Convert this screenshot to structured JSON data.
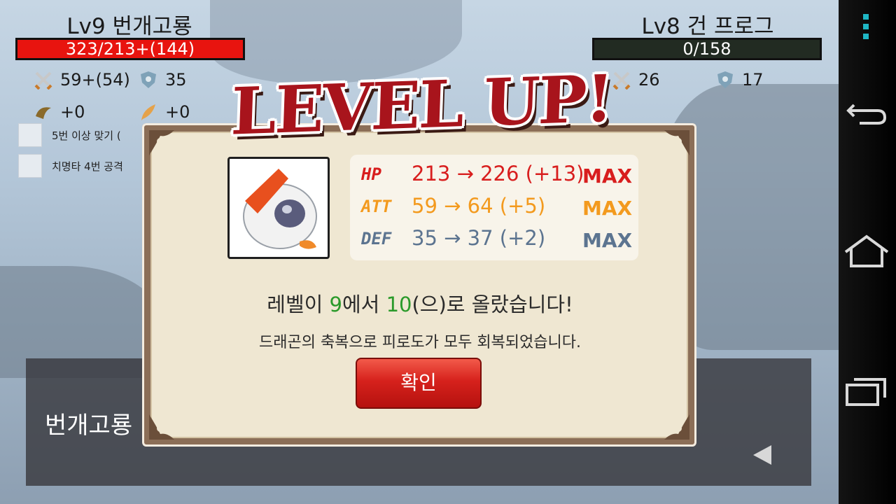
{
  "player": {
    "name": "Lv9 번개고룡",
    "hp_text": "323/213+(144)",
    "attack": "59+(54)",
    "defense": "35",
    "bonus1": "+0",
    "bonus2": "+0"
  },
  "enemy": {
    "name": "Lv8 건 프로그",
    "hp_text": "0/158",
    "attack": "26",
    "defense": "17"
  },
  "quests": [
    {
      "label": "5번 이상 맞기 ("
    },
    {
      "label": "치명타 4번 공격"
    }
  ],
  "message_panel": {
    "speaker": "번개고룡"
  },
  "dialog": {
    "title": "LEVEL UP!",
    "stats": [
      {
        "label": "HP",
        "value": "213 → 226 (+13)",
        "max": "MAX",
        "color": "#d81e1e"
      },
      {
        "label": "ATT",
        "value": "59 → 64 (+5)",
        "max": "MAX",
        "color": "#f39a1e"
      },
      {
        "label": "DEF",
        "value": "35 → 37 (+2)",
        "max": "MAX",
        "color": "#5c7490"
      }
    ],
    "line1_a": "레벨이 ",
    "line1_b": "9",
    "line1_c": "에서 ",
    "line1_d": "10",
    "line1_e": "(으)로 올랐습니다!",
    "line2": "드래곤의 축복으로 피로도가 모두 회복되었습니다.",
    "confirm_label": "확인"
  },
  "colors": {
    "player_hp": "#e8140f",
    "enemy_hp": "#222b22",
    "accent_green": "#2a9a2a"
  }
}
